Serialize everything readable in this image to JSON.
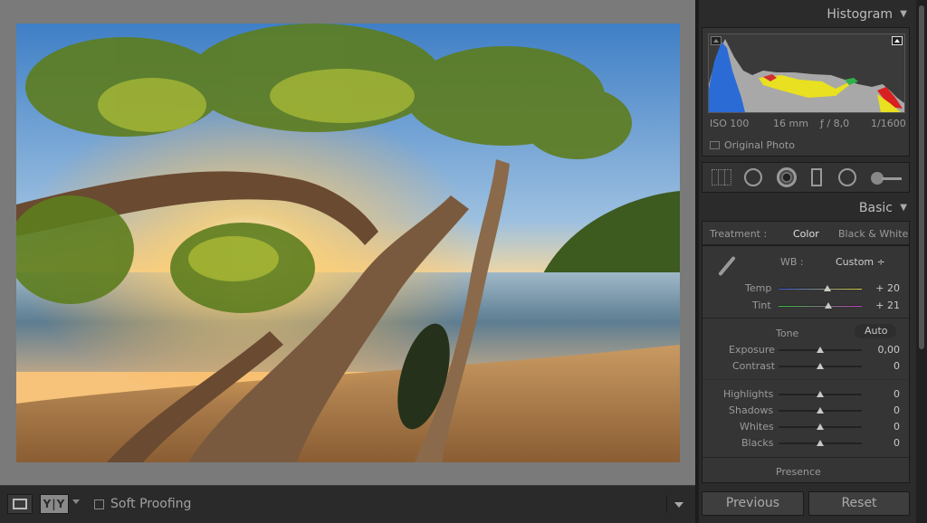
{
  "histogram": {
    "title": "Histogram",
    "iso": "ISO 100",
    "focal": "16 mm",
    "aperture": "ƒ / 8,0",
    "shutter": "1/1600",
    "original_photo": "Original Photo"
  },
  "basic": {
    "title": "Basic",
    "treatment_label": "Treatment :",
    "treatment_color": "Color",
    "treatment_bw": "Black & White",
    "wb_label": "WB :",
    "wb_value": "Custom ÷",
    "temp_label": "Temp",
    "temp_value": "+ 20",
    "tint_label": "Tint",
    "tint_value": "+ 21",
    "tone_label": "Tone",
    "auto_label": "Auto",
    "exposure_label": "Exposure",
    "exposure_value": "0,00",
    "contrast_label": "Contrast",
    "contrast_value": "0",
    "highlights_label": "Highlights",
    "highlights_value": "0",
    "shadows_label": "Shadows",
    "shadows_value": "0",
    "whites_label": "Whites",
    "whites_value": "0",
    "blacks_label": "Blacks",
    "blacks_value": "0",
    "presence_label": "Presence"
  },
  "toolbar": {
    "soft_proofing": "Soft Proofing"
  },
  "buttons": {
    "previous": "Previous",
    "reset": "Reset"
  }
}
